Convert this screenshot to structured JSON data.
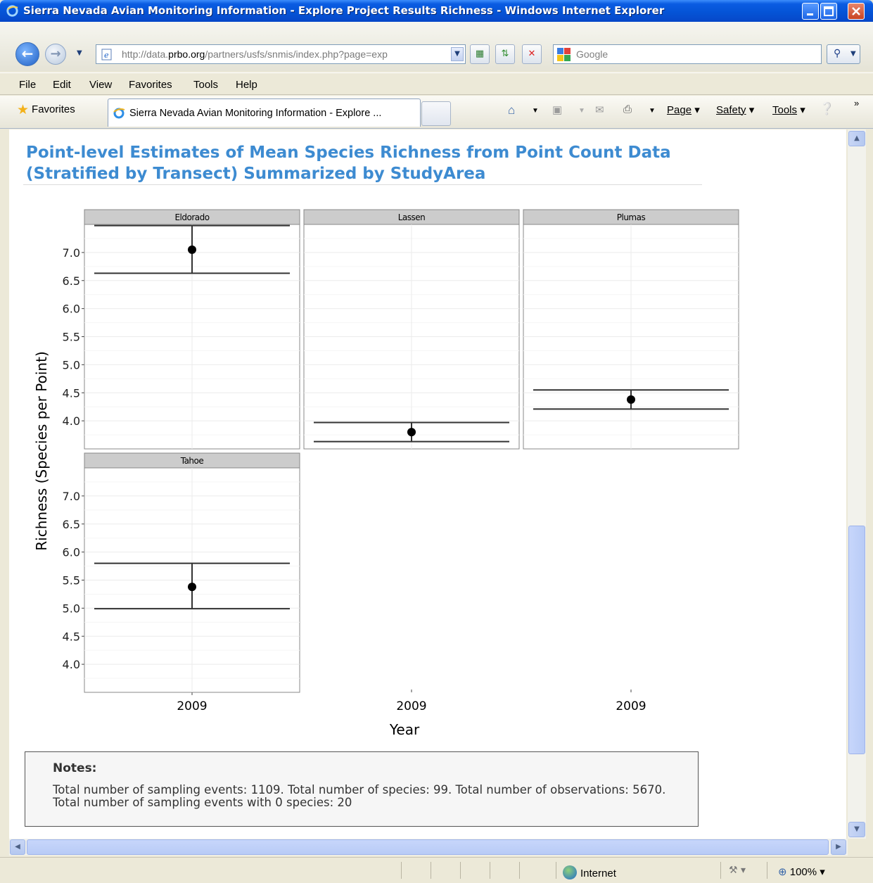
{
  "window": {
    "title": "Sierra Nevada Avian Monitoring Information - Explore Project Results Richness - Windows Internet Explorer"
  },
  "addressbar": {
    "url_prefix": "http://data.",
    "url_domain": "prbo.org",
    "url_suffix": "/partners/usfs/snmis/index.php?page=exp"
  },
  "search": {
    "placeholder": "Google"
  },
  "menu": {
    "items": [
      "File",
      "Edit",
      "View",
      "Favorites",
      "Tools",
      "Help"
    ]
  },
  "tabs": {
    "favorites_label": "Favorites",
    "active_tab_label": "Sierra Nevada Avian Monitoring Information - Explore ..."
  },
  "commandbar": {
    "page_label": "Page",
    "safety_label": "Safety",
    "tools_label": "Tools"
  },
  "page": {
    "heading": "Point-level Estimates of Mean Species Richness from Point Count Data (Stratified by Transect) Summarized by StudyArea"
  },
  "notes": {
    "title": "Notes:",
    "body": "Total number of sampling events: 1109. Total number of species: 99. Total number of observations: 5670. Total number of sampling events with 0 species: 20"
  },
  "statusbar": {
    "zone_label": "Internet",
    "zoom_label": "100%"
  },
  "colors": {
    "heading": "#3d8bd1",
    "titlebar": "#0554d7",
    "strip": "#cccccc"
  },
  "chart_data": {
    "type": "scatter",
    "xlabel": "Year",
    "ylabel": "Richness (Species per Point)",
    "ylim": [
      3.5,
      7.5
    ],
    "yticks": [
      "4.0",
      "4.5",
      "5.0",
      "5.5",
      "6.0",
      "6.5",
      "7.0"
    ],
    "x_tick": "2009",
    "bottom_x_ticks": [
      "2009",
      "2009",
      "2009"
    ],
    "panels": [
      {
        "name": "Eldorado",
        "x": 2009,
        "y": 7.05,
        "lower": 6.63,
        "upper": 7.48
      },
      {
        "name": "Lassen",
        "x": 2009,
        "y": 3.8,
        "lower": 3.63,
        "upper": 3.97
      },
      {
        "name": "Plumas",
        "x": 2009,
        "y": 4.38,
        "lower": 4.21,
        "upper": 4.55
      },
      {
        "name": "Tahoe",
        "x": 2009,
        "y": 5.38,
        "lower": 4.99,
        "upper": 5.8
      }
    ]
  }
}
